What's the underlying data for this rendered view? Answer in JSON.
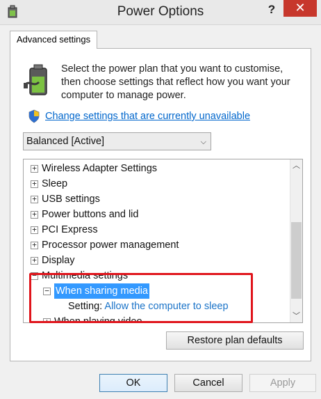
{
  "window": {
    "title": "Power Options",
    "help_label": "?",
    "close_label": "✕"
  },
  "tab": {
    "label": "Advanced settings"
  },
  "description": "Select the power plan that you want to customise, then choose settings that reflect how you want your computer to manage power.",
  "change_link": "Change settings that are currently unavailable",
  "plan_select": {
    "value": "Balanced [Active]"
  },
  "tree": {
    "items": [
      {
        "label": "Wireless Adapter Settings",
        "expander": "+"
      },
      {
        "label": "Sleep",
        "expander": "+"
      },
      {
        "label": "USB settings",
        "expander": "+"
      },
      {
        "label": "Power buttons and lid",
        "expander": "+"
      },
      {
        "label": "PCI Express",
        "expander": "+"
      },
      {
        "label": "Processor power management",
        "expander": "+"
      },
      {
        "label": "Display",
        "expander": "+"
      },
      {
        "label": "Multimedia settings",
        "expander": "−"
      },
      {
        "label": "When sharing media",
        "expander": "−"
      },
      {
        "label": "When playing video",
        "expander": "+"
      }
    ],
    "setting_label": "Setting:",
    "setting_value": "Allow the computer to sleep"
  },
  "buttons": {
    "restore": "Restore plan defaults",
    "ok": "OK",
    "cancel": "Cancel",
    "apply": "Apply"
  },
  "colors": {
    "selection": "#3399ff",
    "link": "#0066cc",
    "highlight_box": "#e0141b",
    "close_button": "#c7372c"
  }
}
